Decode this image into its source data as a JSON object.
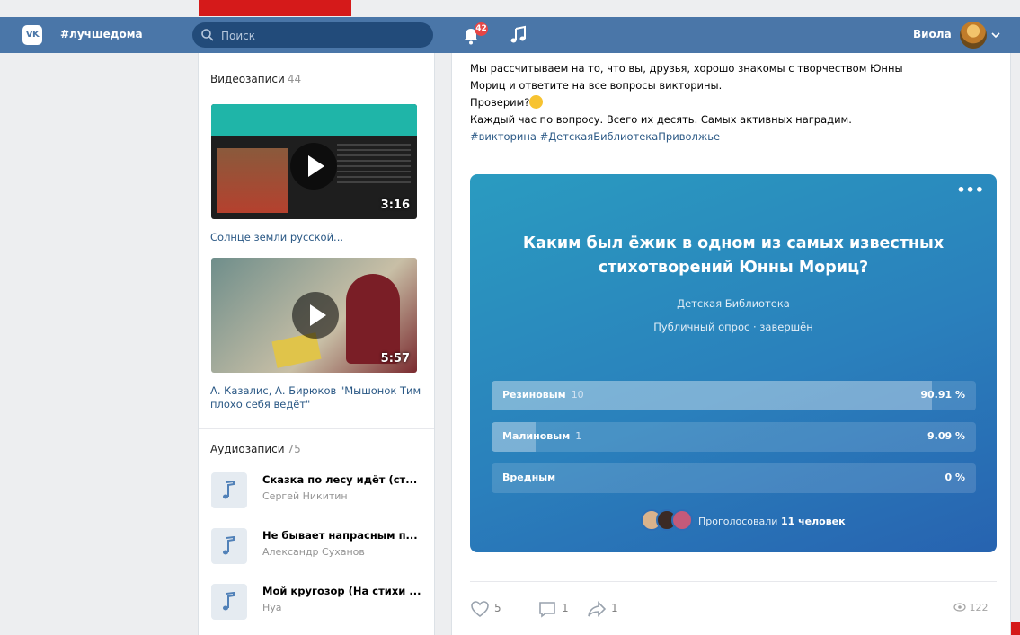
{
  "topbar": {
    "logo": "VK",
    "brand": "#лучшедома",
    "search_placeholder": "Поиск",
    "notifications_badge": "42",
    "user_name": "Виола"
  },
  "sidebar": {
    "videos_title": "Видеозаписи",
    "videos_count": "44",
    "videos": [
      {
        "title": "Солнце земли русской...",
        "duration": "3:16"
      },
      {
        "title": "А. Казалис, А. Бирюков \"Мышонок Тим плохо себя ведёт\"",
        "duration": "5:57"
      }
    ],
    "audio_title": "Аудиозаписи",
    "audio_count": "75",
    "audios": [
      {
        "title": "Сказка по лесу идёт (ст...",
        "artist": "Сергей Никитин"
      },
      {
        "title": "Не бывает напрасным п...",
        "artist": "Александр Суханов"
      },
      {
        "title": "Мой кругозор (На стихи ...",
        "artist": "Нуа"
      }
    ]
  },
  "post": {
    "text_line1": "Мы рассчитываем на то, что вы, друзья, хорошо знакомы с творчеством Юнны",
    "text_line2": "Мориц и ответите на все вопросы викторины.",
    "text_line3": "Проверим?",
    "text_line4": "Каждый час по вопросу. Всего их десять. Самых активных наградим.",
    "hashtags": "#викторина #ДетскаяБиблиотекаПриволжье",
    "poll": {
      "question": "Каким был ёжик в одном из самых известных стихотворений Юнны Мориц?",
      "author": "Детская Библиотека",
      "status": "Публичный опрос · завершён",
      "options": [
        {
          "label": "Резиновым",
          "count": "10",
          "percent_text": "90.91 %",
          "fraction": 0.9091
        },
        {
          "label": "Малиновым",
          "count": "1",
          "percent_text": "9.09 %",
          "fraction": 0.0909
        },
        {
          "label": "Вредным",
          "count": "",
          "percent_text": "0 %",
          "fraction": 0
        }
      ],
      "voters_text": "Проголосовали",
      "voters_count": "11 человек"
    },
    "likes": "5",
    "comments": "1",
    "shares": "1",
    "views": "122"
  },
  "colors": {
    "header": "#4a76a8",
    "link": "#2a5885",
    "poll_gradient_start": "#2a9bc0",
    "poll_gradient_end": "#2763b0",
    "red_marker": "#d51a1a"
  }
}
